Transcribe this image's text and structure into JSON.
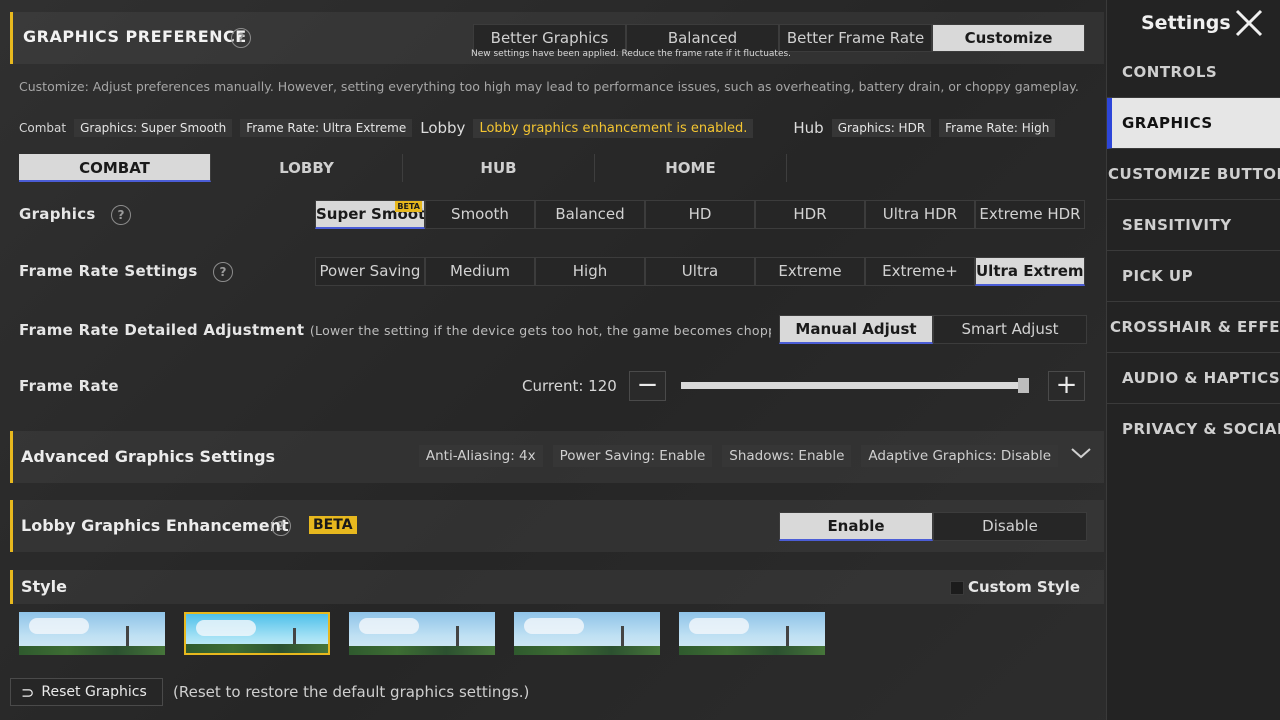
{
  "header": {
    "title": "GRAPHICS PREFERENCE",
    "tabs": [
      "Better Graphics",
      "Balanced",
      "Better Frame Rate",
      "Customize"
    ],
    "active_tab": "Customize",
    "note": "New settings have been applied. Reduce the frame rate if it fluctuates.",
    "description": "Customize: Adjust preferences manually. However, setting everything too high may lead to performance issues, such as overheating, battery drain, or choppy gameplay."
  },
  "summary": {
    "combat_label": "Combat",
    "combat_graphics": "Graphics: Super Smooth",
    "combat_frame": "Frame Rate: Ultra Extreme",
    "lobby_label": "Lobby",
    "lobby_status": "Lobby graphics enhancement is enabled.",
    "hub_label": "Hub",
    "hub_graphics": "Graphics: HDR",
    "hub_frame": "Frame Rate: High"
  },
  "mode_tabs": [
    "COMBAT",
    "LOBBY",
    "HUB",
    "HOME"
  ],
  "graphics": {
    "label": "Graphics",
    "options": [
      "Super Smooth",
      "Smooth",
      "Balanced",
      "HD",
      "HDR",
      "Ultra HDR",
      "Extreme HDR"
    ],
    "selected": "Super Smooth",
    "beta_tag": "BETA"
  },
  "frame_rate_settings": {
    "label": "Frame Rate Settings",
    "options": [
      "Power Saving",
      "Medium",
      "High",
      "Ultra",
      "Extreme",
      "Extreme+",
      "Ultra Extreme"
    ],
    "selected": "Ultra Extreme"
  },
  "detailed_adjustment": {
    "label": "Frame Rate Detailed Adjustment",
    "note": "(Lower the setting if the device gets too hot, the game becomes choppy, or th",
    "options": [
      "Manual Adjust",
      "Smart Adjust"
    ],
    "selected": "Manual Adjust"
  },
  "frame_rate": {
    "label": "Frame Rate",
    "current": "Current: 120",
    "minus": "−",
    "plus": "+",
    "level": 1.0
  },
  "advanced": {
    "title": "Advanced Graphics Settings",
    "chips": [
      "Anti-Aliasing: 4x",
      "Power Saving: Enable",
      "Shadows: Enable",
      "Adaptive Graphics: Disable"
    ]
  },
  "lobby_enhancement": {
    "title": "Lobby Graphics Enhancement",
    "beta": "BETA",
    "options": [
      "Enable",
      "Disable"
    ],
    "selected": "Enable"
  },
  "style": {
    "title": "Style",
    "custom_label": "Custom Style",
    "selected_index": 1
  },
  "footer": {
    "reset_label": "Reset Graphics",
    "reset_note": "(Reset to restore the default graphics settings.)"
  },
  "sidebar": {
    "title": "Settings",
    "items": [
      "CONTROLS",
      "GRAPHICS",
      "CUSTOMIZE BUTTONS",
      "SENSITIVITY",
      "PICK UP",
      "CROSSHAIR & EFFECTS",
      "AUDIO & HAPTICS",
      "PRIVACY & SOCIAL"
    ],
    "active": "GRAPHICS"
  },
  "colors": {
    "accent": "#e7b81e",
    "active_blue": "#2d46d9",
    "selected_bg": "#d9d9d9"
  }
}
